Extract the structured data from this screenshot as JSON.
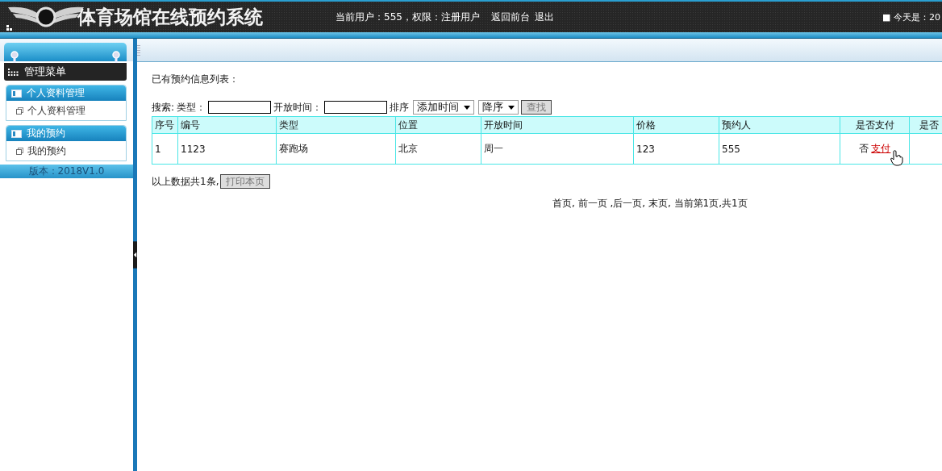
{
  "header": {
    "title": "体育场馆在线预约系统",
    "user_info": "当前用户：555，权限：注册用户",
    "links": [
      "返回前台",
      "退出"
    ],
    "date": "■ 今天是：20"
  },
  "sidebar": {
    "menu_title": "管理菜单",
    "groups": [
      {
        "title": "个人资料管理",
        "items": [
          {
            "label": "个人资料管理"
          }
        ]
      },
      {
        "title": "我的预约",
        "items": [
          {
            "label": "我的预约"
          }
        ]
      }
    ],
    "version": "版本：2018V1.0"
  },
  "content": {
    "heading": "已有预约信息列表：",
    "search": {
      "label": "搜索:",
      "fields": [
        {
          "label": "类型："
        },
        {
          "label": "开放时间："
        }
      ],
      "sort_label": "排序",
      "selects": [
        "添加时间",
        "降序"
      ],
      "button": "查找"
    },
    "table": {
      "columns": [
        "序号",
        "编号",
        "类型",
        "位置",
        "开放时间",
        "价格",
        "预约人",
        "是否支付",
        "是否"
      ],
      "rows": [
        {
          "cells": [
            "1",
            "1123",
            "赛跑场",
            "北京",
            "周一",
            "123",
            "555"
          ],
          "paid": "否",
          "pay_link": "支付"
        }
      ]
    },
    "summary": "以上数据共1条,",
    "print_button": "打印本页",
    "pagination": "首页, 前一页 ,后一页, 末页, 当前第1页,共1页"
  }
}
